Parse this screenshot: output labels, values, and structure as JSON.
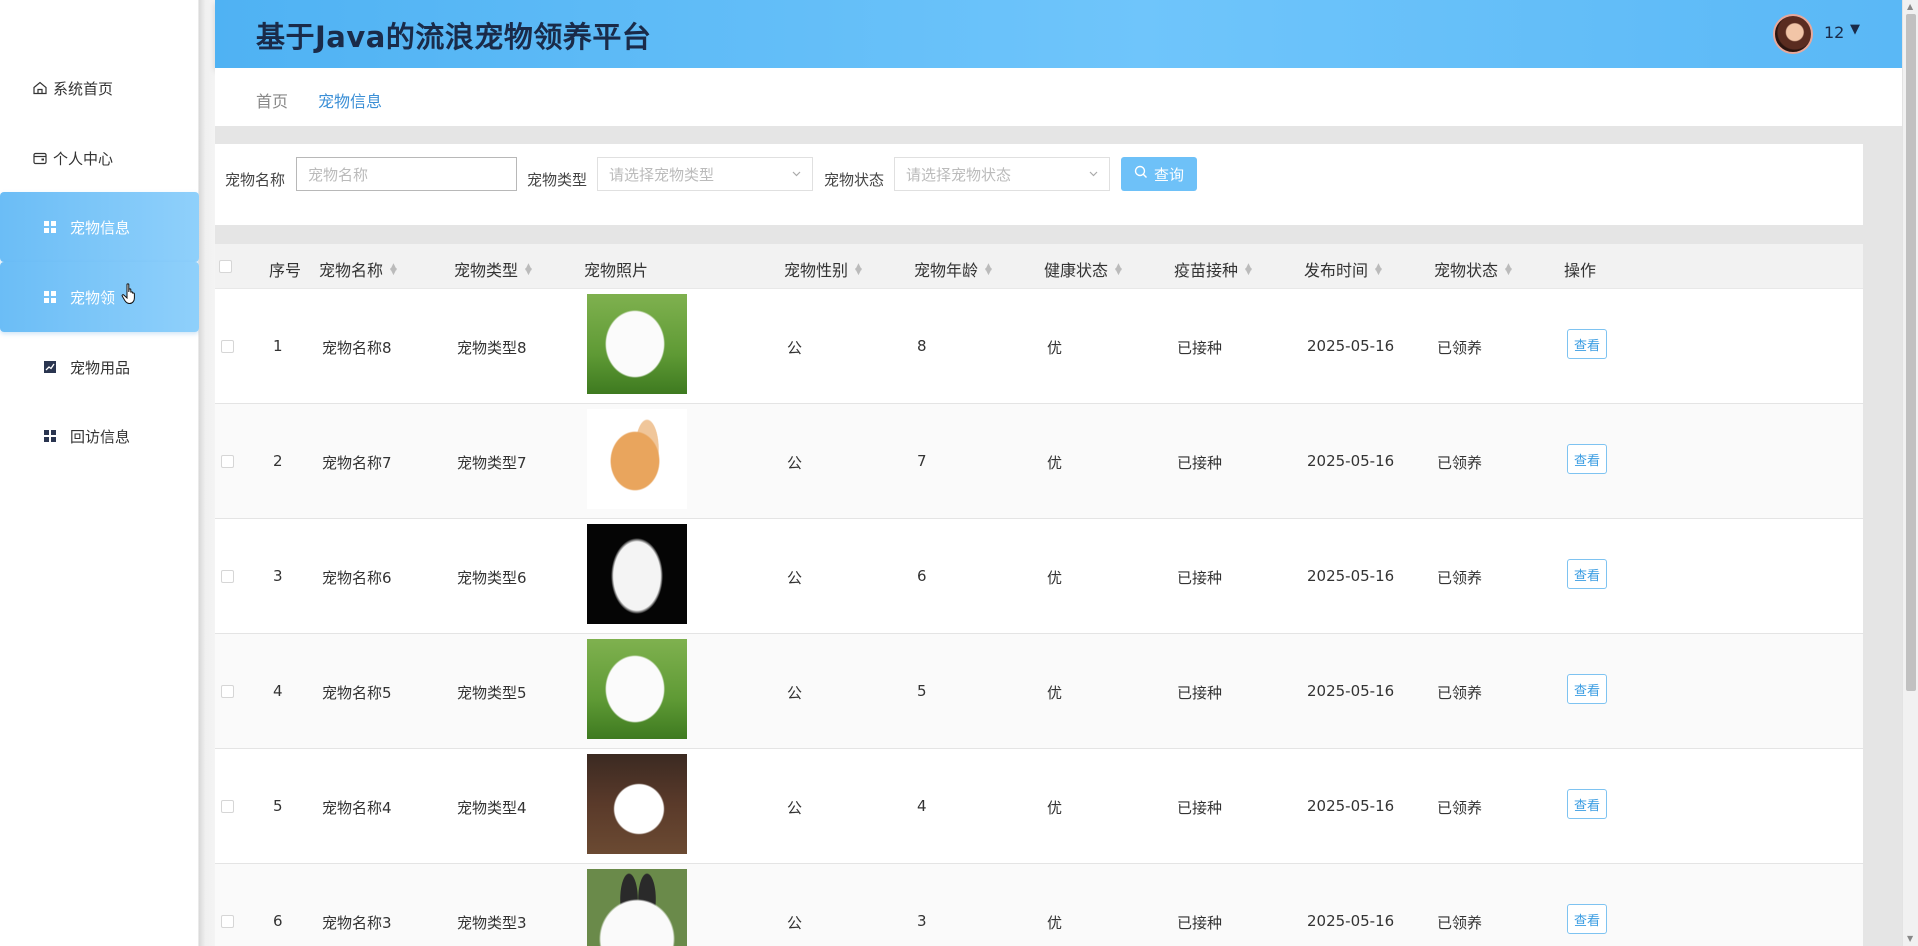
{
  "app": {
    "title": "基于Java的流浪宠物领养平台"
  },
  "user": {
    "name": "12"
  },
  "sidebar": {
    "items": [
      {
        "label": "系统首页",
        "icon": "home-icon"
      },
      {
        "label": "个人中心",
        "icon": "wallet-icon"
      },
      {
        "label": "宠物信息",
        "icon": "grid-icon"
      },
      {
        "label": "宠物领",
        "icon": "grid-icon"
      },
      {
        "label": "宠物用品",
        "icon": "chart-icon"
      },
      {
        "label": "回访信息",
        "icon": "grid-icon"
      }
    ]
  },
  "breadcrumb": {
    "home": "首页",
    "current": "宠物信息"
  },
  "search": {
    "name_label": "宠物名称",
    "name_placeholder": "宠物名称",
    "type_label": "宠物类型",
    "type_placeholder": "请选择宠物类型",
    "status_label": "宠物状态",
    "status_placeholder": "请选择宠物状态",
    "button_label": "查询"
  },
  "table": {
    "columns": [
      "序号",
      "宠物名称",
      "宠物类型",
      "宠物照片",
      "宠物性别",
      "宠物年龄",
      "健康状态",
      "疫苗接种",
      "发布时间",
      "宠物状态",
      "操作"
    ],
    "view_label": "查看",
    "rows": [
      {
        "index": "1",
        "name": "宠物名称8",
        "type": "宠物类型8",
        "photo": "samoyed",
        "gender": "公",
        "age": "8",
        "health": "优",
        "vaccine": "已接种",
        "time": "2025-05-16",
        "status": "已领养"
      },
      {
        "index": "2",
        "name": "宠物名称7",
        "type": "宠物类型7",
        "photo": "bunny",
        "gender": "公",
        "age": "7",
        "health": "优",
        "vaccine": "已接种",
        "time": "2025-05-16",
        "status": "已领养"
      },
      {
        "index": "3",
        "name": "宠物名称6",
        "type": "宠物类型6",
        "photo": "cat",
        "gender": "公",
        "age": "6",
        "health": "优",
        "vaccine": "已接种",
        "time": "2025-05-16",
        "status": "已领养"
      },
      {
        "index": "4",
        "name": "宠物名称5",
        "type": "宠物类型5",
        "photo": "samoyed",
        "gender": "公",
        "age": "5",
        "health": "优",
        "vaccine": "已接种",
        "time": "2025-05-16",
        "status": "已领养"
      },
      {
        "index": "5",
        "name": "宠物名称4",
        "type": "宠物类型4",
        "photo": "pom",
        "gender": "公",
        "age": "4",
        "health": "优",
        "vaccine": "已接种",
        "time": "2025-05-16",
        "status": "已领养"
      },
      {
        "index": "6",
        "name": "宠物名称3",
        "type": "宠物类型3",
        "photo": "rabbit",
        "gender": "公",
        "age": "3",
        "health": "优",
        "vaccine": "已接种",
        "time": "2025-05-16",
        "status": "已领养"
      }
    ]
  },
  "colors": {
    "accent": "#6ec1f8",
    "header_start": "#4fb2f3",
    "header_end": "#6fc5fb",
    "link": "#3b8fd6"
  }
}
